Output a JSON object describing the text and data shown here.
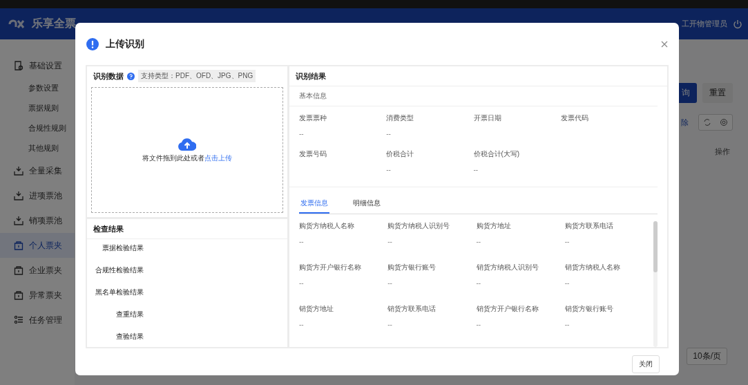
{
  "app": {
    "logo": "乐享全票",
    "user": "工开物管理员"
  },
  "sidebar": {
    "items": [
      {
        "label": "基础设置",
        "selected": false,
        "children": [
          {
            "label": "参数设置",
            "selected": false
          },
          {
            "label": "票据规则",
            "selected": false
          },
          {
            "label": "合规性规则",
            "selected": false
          },
          {
            "label": "其他规则",
            "selected": false
          }
        ]
      },
      {
        "label": "全量采集",
        "selected": false
      },
      {
        "label": "进项票池",
        "selected": false
      },
      {
        "label": "销项票池",
        "selected": false
      },
      {
        "label": "个人票夹",
        "selected": true
      },
      {
        "label": "企业票夹",
        "selected": false
      },
      {
        "label": "异常票夹",
        "selected": false
      },
      {
        "label": "任务管理",
        "selected": false
      }
    ]
  },
  "background": {
    "query_button": "询",
    "reset_button": "重置",
    "delete_link": "除",
    "column_header": "操作",
    "page_size": "10条/页"
  },
  "dialog": {
    "title": "上传识别",
    "upload": {
      "title": "识别数据",
      "formats": "支持类型：PDF、OFD、JPG、PNG",
      "hint": "将文件拖到此处或者",
      "link": "点击上传"
    },
    "checks": {
      "title": "检查结果",
      "items": [
        "票据检验结果",
        "合规性检验结果",
        "黑名单检验结果",
        "查重结果",
        "查验结果"
      ]
    },
    "result": {
      "title": "识别结果",
      "section": "基本信息",
      "basic_fields": [
        {
          "label": "发票票种",
          "value": "--"
        },
        {
          "label": "消费类型",
          "value": "--"
        },
        {
          "label": "开票日期"
        },
        {
          "label": "发票代码"
        },
        {
          "label": "发票号码"
        },
        {
          "label": "价税合计",
          "value": "--"
        },
        {
          "label": "价税合计(大写)",
          "value": "--"
        }
      ],
      "tabs": [
        {
          "label": "发票信息",
          "selected": true
        },
        {
          "label": "明细信息",
          "selected": false
        }
      ],
      "invoice_fields": [
        {
          "label": "购货方纳税人名称",
          "value": "--"
        },
        {
          "label": "购货方纳税人识别号",
          "value": "--"
        },
        {
          "label": "购货方地址",
          "value": "--"
        },
        {
          "label": "购货方联系电话",
          "value": "--"
        },
        {
          "label": "购货方开户银行名称",
          "value": "--"
        },
        {
          "label": "购货方银行账号",
          "value": "--"
        },
        {
          "label": "销货方纳税人识别号",
          "value": "--"
        },
        {
          "label": "销货方纳税人名称",
          "value": "--"
        },
        {
          "label": "销货方地址",
          "value": "--"
        },
        {
          "label": "销货方联系电话",
          "value": "--"
        },
        {
          "label": "销货方开户银行名称",
          "value": "--"
        },
        {
          "label": "销货方银行账号",
          "value": "--"
        }
      ]
    },
    "close_button": "关闭"
  }
}
